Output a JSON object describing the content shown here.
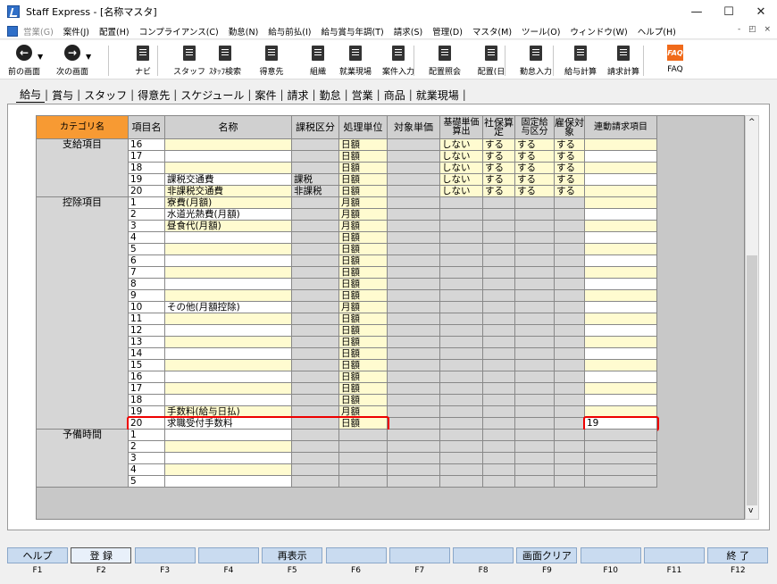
{
  "window": {
    "title": "Staff Express - [名称マスタ]",
    "min": "—",
    "max": "☐",
    "close": "✕"
  },
  "menu": [
    {
      "label": "営業(G)",
      "disabled": true
    },
    {
      "label": "案件(J)"
    },
    {
      "label": "配置(H)"
    },
    {
      "label": "コンプライアンス(C)"
    },
    {
      "label": "勤怠(N)"
    },
    {
      "label": "給与前払(I)"
    },
    {
      "label": "給与賞与年調(T)"
    },
    {
      "label": "請求(S)"
    },
    {
      "label": "管理(D)"
    },
    {
      "label": "マスタ(M)"
    },
    {
      "label": "ツール(O)"
    },
    {
      "label": "ウィンドウ(W)"
    },
    {
      "label": "ヘルプ(H)"
    }
  ],
  "mdi": "- ◰ ×",
  "toolbar": [
    {
      "label": "前の画面",
      "icon": "back-arrow-icon"
    },
    {
      "label": "次の画面",
      "icon": "forward-arrow-icon"
    },
    {
      "label": "ナビ",
      "icon": "navi-icon"
    },
    {
      "label": "スタッフ",
      "icon": "staff-icon"
    },
    {
      "label": "ｽﾀｯﾌ検索",
      "icon": "staff-search-icon"
    },
    {
      "label": "得意先",
      "icon": "customer-icon"
    },
    {
      "label": "組織",
      "icon": "organization-icon"
    },
    {
      "label": "就業現場",
      "icon": "worksite-icon"
    },
    {
      "label": "案件入力",
      "icon": "case-entry-icon"
    },
    {
      "label": "配置照会",
      "icon": "placement-inquiry-icon"
    },
    {
      "label": "配置(日",
      "icon": "placement-daily-icon"
    },
    {
      "label": "勤怠入力",
      "icon": "attendance-entry-icon"
    },
    {
      "label": "給与計算",
      "icon": "payroll-calc-icon"
    },
    {
      "label": "請求計算",
      "icon": "billing-calc-icon"
    },
    {
      "label": "FAQ",
      "icon": "faq-icon"
    }
  ],
  "tabs": [
    "給与",
    "賞与",
    "スタッフ",
    "得意先",
    "スケジュール",
    "案件",
    "請求",
    "勤怠",
    "営業",
    "商品",
    "就業現場"
  ],
  "grid": {
    "headers": [
      "カテゴリ名",
      "項目名",
      "名称",
      "課税区分",
      "処理単位",
      "対象単価",
      "基礎単価算出",
      "社保算定",
      "固定給与区分",
      "雇保対象",
      "連動請求項目"
    ],
    "groups": [
      {
        "category": "支給項目",
        "rows": [
          {
            "no": "16",
            "name": "",
            "tax": "",
            "unit": "日額",
            "base": "しない",
            "shaho": "する",
            "fixed": "する",
            "koyo": "する",
            "link": ""
          },
          {
            "no": "17",
            "name": "",
            "tax": "",
            "unit": "日額",
            "base": "しない",
            "shaho": "する",
            "fixed": "する",
            "koyo": "する",
            "link": ""
          },
          {
            "no": "18",
            "name": "",
            "tax": "",
            "unit": "日額",
            "base": "しない",
            "shaho": "する",
            "fixed": "する",
            "koyo": "する",
            "link": ""
          },
          {
            "no": "19",
            "name": "課税交通費",
            "tax": "課税",
            "unit": "日額",
            "base": "しない",
            "shaho": "する",
            "fixed": "する",
            "koyo": "する",
            "link": ""
          },
          {
            "no": "20",
            "name": "非課税交通費",
            "tax": "非課税",
            "unit": "日額",
            "base": "しない",
            "shaho": "する",
            "fixed": "する",
            "koyo": "する",
            "link": ""
          }
        ]
      },
      {
        "category": "控除項目",
        "rows": [
          {
            "no": "1",
            "name": "寮費(月額)",
            "unit": "月額"
          },
          {
            "no": "2",
            "name": "水道光熱費(月額)",
            "unit": "月額"
          },
          {
            "no": "3",
            "name": "昼食代(月額)",
            "unit": "月額"
          },
          {
            "no": "4",
            "name": "",
            "unit": "日額"
          },
          {
            "no": "5",
            "name": "",
            "unit": "日額"
          },
          {
            "no": "6",
            "name": "",
            "unit": "日額"
          },
          {
            "no": "7",
            "name": "",
            "unit": "日額"
          },
          {
            "no": "8",
            "name": "",
            "unit": "日額"
          },
          {
            "no": "9",
            "name": "",
            "unit": "日額"
          },
          {
            "no": "10",
            "name": "その他(月額控除)",
            "unit": "月額"
          },
          {
            "no": "11",
            "name": "",
            "unit": "日額"
          },
          {
            "no": "12",
            "name": "",
            "unit": "日額"
          },
          {
            "no": "13",
            "name": "",
            "unit": "日額"
          },
          {
            "no": "14",
            "name": "",
            "unit": "日額"
          },
          {
            "no": "15",
            "name": "",
            "unit": "日額"
          },
          {
            "no": "16",
            "name": "",
            "unit": "日額"
          },
          {
            "no": "17",
            "name": "",
            "unit": "日額"
          },
          {
            "no": "18",
            "name": "",
            "unit": "日額"
          },
          {
            "no": "19",
            "name": "手数料(給与日払)",
            "unit": "月額"
          },
          {
            "no": "20",
            "name": "求職受付手数料",
            "unit": "日額",
            "link": "19",
            "highlight": true
          }
        ]
      },
      {
        "category": "予備時間",
        "rows": [
          {
            "no": "1",
            "name": ""
          },
          {
            "no": "2",
            "name": ""
          },
          {
            "no": "3",
            "name": ""
          },
          {
            "no": "4",
            "name": ""
          },
          {
            "no": "5",
            "name": ""
          }
        ]
      }
    ]
  },
  "fkeys": [
    {
      "label": "ヘルプ",
      "key": "F1"
    },
    {
      "label": "登 録",
      "key": "F2",
      "active": true
    },
    {
      "label": "",
      "key": "F3"
    },
    {
      "label": "",
      "key": "F4"
    },
    {
      "label": "再表示",
      "key": "F5"
    },
    {
      "label": "",
      "key": "F6"
    },
    {
      "label": "",
      "key": "F7"
    },
    {
      "label": "",
      "key": "F8"
    },
    {
      "label": "画面クリア",
      "key": "F9"
    },
    {
      "label": "",
      "key": "F10"
    },
    {
      "label": "",
      "key": "F11"
    },
    {
      "label": "終 了",
      "key": "F12"
    }
  ]
}
